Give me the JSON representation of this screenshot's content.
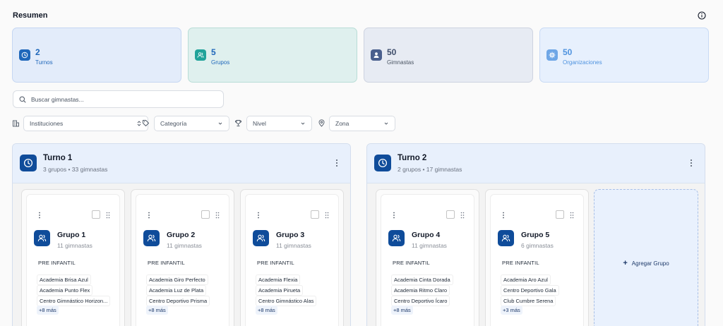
{
  "header": {
    "title": "Resumen"
  },
  "stats": [
    {
      "value": "2",
      "label": "Turnos",
      "bg": "#e3ecfa",
      "border": "#c5d6f2",
      "icon_bg": "#1f67ba",
      "num_color": "#1f67ba",
      "lbl_color": "#1f67ba",
      "icon": "clock-icon"
    },
    {
      "value": "5",
      "label": "Grupos",
      "bg": "#dff0ee",
      "border": "#b8ddd7",
      "icon_bg": "#21a39a",
      "num_color": "#1f67ba",
      "lbl_color": "#1f67ba",
      "icon": "users-icon"
    },
    {
      "value": "50",
      "label": "Gimnastas",
      "bg": "#e7ebf3",
      "border": "#cdd3e0",
      "icon_bg": "#4a5f8d",
      "num_color": "#3f4e6b",
      "lbl_color": "#4b5563",
      "icon": "user-icon"
    },
    {
      "value": "50",
      "label": "Organizaciones",
      "bg": "#e7f0fd",
      "border": "#c8daf5",
      "icon_bg": "#6ea6e6",
      "num_color": "#4f93df",
      "lbl_color": "#4f93df",
      "icon": "gear-icon"
    }
  ],
  "search": {
    "placeholder": "Buscar gimnastas..."
  },
  "filters": {
    "institutions": "Instituciones",
    "category": "Categoría",
    "level": "Nivel",
    "zone": "Zona"
  },
  "turnos": [
    {
      "title": "Turno 1",
      "subtitle": "3 grupos • 33 gimnastas",
      "groups": [
        {
          "name": "Grupo 1",
          "count": "11 gimnastas",
          "category": "PRE INFANTIL",
          "institutions": [
            "Academia Brisa Azul",
            "Academia Punto Flex",
            "Centro Gimnástico Horizon..."
          ],
          "more": "+8 más"
        },
        {
          "name": "Grupo 2",
          "count": "11 gimnastas",
          "category": "PRE INFANTIL",
          "institutions": [
            "Academia Giro Perfecto",
            "Academia Luz de Plata",
            "Centro Deportivo Prisma"
          ],
          "more": "+8 más"
        },
        {
          "name": "Grupo 3",
          "count": "11 gimnastas",
          "category": "PRE INFANTIL",
          "institutions": [
            "Academia Flexia",
            "Academia Pirueta",
            "Centro Gimnástico Alas"
          ],
          "more": "+8 más"
        }
      ]
    },
    {
      "title": "Turno 2",
      "subtitle": "2 grupos • 17 gimnastas",
      "groups": [
        {
          "name": "Grupo 4",
          "count": "11 gimnastas",
          "category": "PRE INFANTIL",
          "institutions": [
            "Academia Cinta Dorada",
            "Academia Ritmo Claro",
            "Centro Deportivo Ícaro"
          ],
          "more": "+8 más"
        },
        {
          "name": "Grupo 5",
          "count": "6 gimnastas",
          "category": "PRE INFANTIL",
          "institutions": [
            "Academia Aro Azul",
            "Centro Deportivo Gala",
            "Club Cumbre Serena"
          ],
          "more": "+3 más"
        }
      ],
      "add_label": "Agregar Grupo"
    }
  ]
}
